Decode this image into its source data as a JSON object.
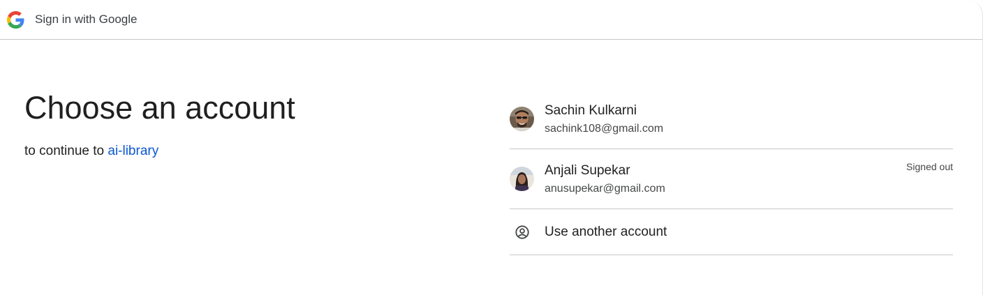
{
  "header": {
    "title": "Sign in with Google",
    "logo_icon": "google-g-icon"
  },
  "main": {
    "headline": "Choose an account",
    "subtitle_prefix": "to continue to ",
    "app_name": "ai-library",
    "link_color": "#0b57d0"
  },
  "accounts": [
    {
      "name": "Sachin Kulkarni",
      "email": "sachink108@gmail.com",
      "status": ""
    },
    {
      "name": "Anjali Supekar",
      "email": "anusupekar@gmail.com",
      "status": "Signed out"
    }
  ],
  "other_account": {
    "label": "Use another account",
    "icon": "account-circle-icon"
  }
}
